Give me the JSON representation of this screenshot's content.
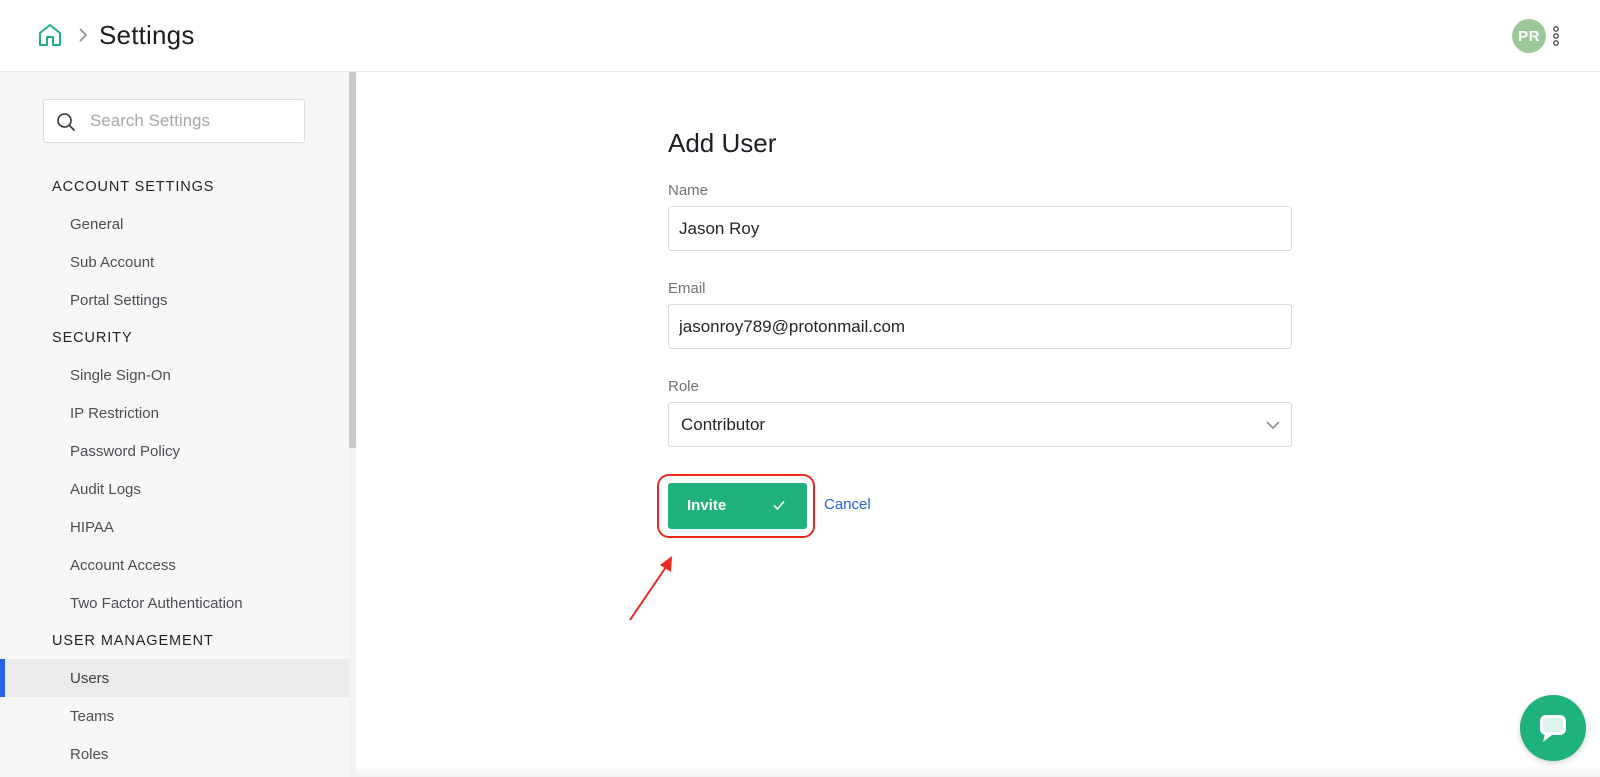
{
  "header": {
    "breadcrumb_home_icon": "home-icon",
    "breadcrumb_separator_icon": "chevron-right-icon",
    "title": "Settings",
    "avatar_initials": "PR",
    "avatar_color": "#9dc89a",
    "menu_icon": "kebab-icon"
  },
  "sidebar": {
    "search": {
      "placeholder": "Search Settings",
      "value": ""
    },
    "sections": [
      {
        "heading": "ACCOUNT SETTINGS",
        "items": [
          "General",
          "Sub Account",
          "Portal Settings"
        ]
      },
      {
        "heading": "SECURITY",
        "items": [
          "Single Sign-On",
          "IP Restriction",
          "Password Policy",
          "Audit Logs",
          "HIPAA",
          "Account Access",
          "Two Factor Authentication"
        ]
      },
      {
        "heading": "USER MANAGEMENT",
        "items": [
          "Users",
          "Teams",
          "Roles"
        ]
      }
    ],
    "active_item": "Users",
    "active_color": "#2762e4"
  },
  "form": {
    "title": "Add User",
    "name": {
      "label": "Name",
      "value": "Jason Roy"
    },
    "email": {
      "label": "Email",
      "value": "jasonroy789@protonmail.com"
    },
    "role": {
      "label": "Role",
      "value": "Contributor"
    },
    "invite_label": "Invite",
    "cancel_label": "Cancel",
    "primary_color": "#1fb27c",
    "highlight_color": "#e8291f"
  },
  "chat_widget": {
    "icon": "chat-bubble-icon"
  }
}
